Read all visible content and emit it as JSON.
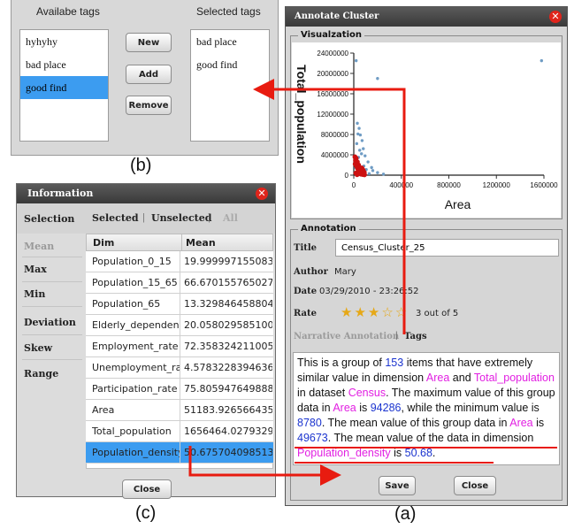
{
  "captions": {
    "b": "(b)",
    "c": "(c)",
    "a": "(a)"
  },
  "tags_panel": {
    "available_heading": "Availabe tags",
    "selected_heading": "Selected tags",
    "available": [
      "hyhyhy",
      "bad place",
      "good find"
    ],
    "selected_available_index": 2,
    "selected": [
      "bad place",
      "good find"
    ],
    "buttons": {
      "new": "New",
      "add": "Add",
      "remove": "Remove"
    }
  },
  "info_panel": {
    "title": "Information",
    "left_items": [
      "Selection",
      "Mean",
      "Max",
      "Min",
      "Deviation",
      "Skew",
      "Range"
    ],
    "active_item": "Mean",
    "filters": {
      "selected": "Selected",
      "separator": "|",
      "unselected": "Unselected",
      "all": "All"
    },
    "columns": [
      "Dim",
      "Mean"
    ],
    "rows": [
      [
        "Population_0_15",
        "19.999997155083"
      ],
      [
        "Population_15_65",
        "66.670155765027"
      ],
      [
        "Population_65",
        "13.329846458804"
      ],
      [
        "Elderly_dependency",
        "20.058029585100"
      ],
      [
        "Employment_rate",
        "72.358324211005"
      ],
      [
        "Unemployment_rate",
        "4.5783228394636"
      ],
      [
        "Participation_rate",
        "75.805947649888"
      ],
      [
        "Area",
        "51183.926566435"
      ],
      [
        "Total_population",
        "1656464.0279329"
      ],
      [
        "Population_density",
        "50.675704098513"
      ]
    ],
    "selected_row": 9,
    "close": "Close"
  },
  "annotate_panel": {
    "title": "Annotate Cluster",
    "visualization_label": "Visualzation",
    "annotation_label": "Annotation",
    "chart_data": {
      "type": "scatter",
      "xlabel": "Area",
      "ylabel": "Total_population",
      "xlim": [
        0,
        1600000
      ],
      "ylim": [
        0,
        24000000
      ],
      "x_ticks": [
        "0",
        "400000",
        "800000",
        "1200000",
        "1600000"
      ],
      "y_ticks": [
        "0",
        "4000000",
        "8000000",
        "12000000",
        "16000000",
        "20000000",
        "24000000"
      ],
      "series": [
        {
          "color": "#6f9cc4",
          "points": [
            [
              20000,
              22500000
            ],
            [
              200000,
              19000000
            ],
            [
              1580000,
              22500000
            ],
            [
              30000,
              10200000
            ],
            [
              45000,
              9200000
            ],
            [
              55000,
              7900000
            ],
            [
              35000,
              8100000
            ],
            [
              70000,
              6800000
            ],
            [
              25000,
              6200000
            ],
            [
              80000,
              5200000
            ],
            [
              50000,
              4900000
            ],
            [
              65000,
              4200000
            ],
            [
              95000,
              3800000
            ],
            [
              40000,
              3500000
            ],
            [
              120000,
              2600000
            ],
            [
              85000,
              1800000
            ],
            [
              150000,
              1500000
            ],
            [
              105000,
              1100000
            ],
            [
              60000,
              600000
            ],
            [
              200000,
              500000
            ],
            [
              250000,
              200000
            ],
            [
              130000,
              300000
            ],
            [
              15000,
              1500000
            ],
            [
              160000,
              900000
            ]
          ]
        },
        {
          "color": "#cc1111",
          "points": [
            [
              10000,
              3600000
            ],
            [
              20000,
              3300000
            ],
            [
              15000,
              2900000
            ],
            [
              30000,
              2600000
            ],
            [
              25000,
              2300000
            ],
            [
              40000,
              2000000
            ],
            [
              35000,
              1700000
            ],
            [
              50000,
              1500000
            ],
            [
              45000,
              1200000
            ],
            [
              60000,
              1000000
            ],
            [
              55000,
              800000
            ],
            [
              70000,
              600000
            ],
            [
              65000,
              450000
            ],
            [
              80000,
              300000
            ],
            [
              75000,
              150000
            ],
            [
              90000,
              80000
            ],
            [
              85000,
              250000
            ],
            [
              12000,
              2200000
            ],
            [
              22000,
              1800000
            ],
            [
              32000,
              1300000
            ],
            [
              42000,
              900000
            ],
            [
              52000,
              500000
            ],
            [
              62000,
              200000
            ],
            [
              72000,
              700000
            ],
            [
              18000,
              400000
            ],
            [
              28000,
              100000
            ],
            [
              38000,
              650000
            ],
            [
              48000,
              300000
            ],
            [
              58000,
              1100000
            ],
            [
              68000,
              1400000
            ],
            [
              78000,
              1000000
            ],
            [
              88000,
              550000
            ]
          ]
        }
      ]
    },
    "fields": {
      "title_label": "Title",
      "title_value": "Census_Cluster_25",
      "author_label": "Author",
      "author_value": "Mary",
      "date_label": "Date",
      "date_value": "03/29/2010 - 23:26:52",
      "rate_label": "Rate",
      "rating": 3,
      "rating_max": 5,
      "rate_text": "3 out of 5"
    },
    "tabs": {
      "narrative": "Narrative Annotation",
      "separator": "|",
      "tags": "Tags"
    },
    "narrative": {
      "p1": "This is a group of ",
      "n_items": "153",
      "p2": " items that have extremely similar value in dimension ",
      "dim1": "Area",
      "p3": " and ",
      "dim2": "Total_population",
      "p4": " in dataset ",
      "dataset": "Census",
      "p5": ". The maximum value of this group data in ",
      "dim3": "Area",
      "p6": " is ",
      "max_val": "94286",
      "p7": ", while the minimum value is ",
      "min_val": "8780",
      "p8": ". The mean value of this group data in ",
      "dim4": "Area",
      "p9": " is ",
      "mean_val": "49673",
      "p10": ". The mean value of the data in dimension ",
      "dim5": "Population_density",
      "p11": " is ",
      "mean_val2": "50.68",
      "p12": "."
    },
    "buttons": {
      "save": "Save",
      "close": "Close"
    }
  },
  "colors": {
    "highlight": "#3c9cf0",
    "arrow": "#e81b10",
    "close": "#e0241b",
    "blue_text": "#1b34cf",
    "magenta_text": "#e21fe2"
  },
  "icons": [
    "close-icon",
    "star-icon",
    "arrow-icon"
  ]
}
